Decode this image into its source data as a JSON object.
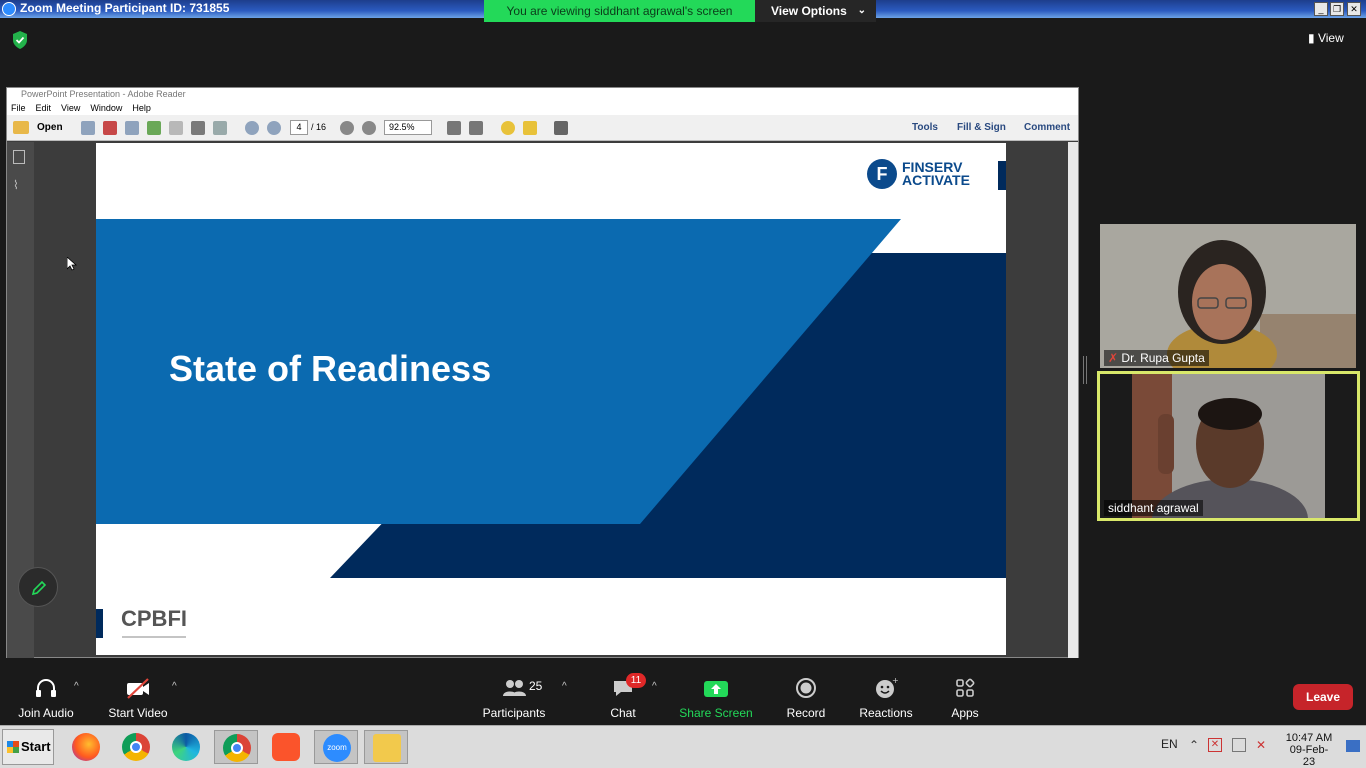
{
  "titlebar": {
    "title": "Zoom Meeting Participant ID: 731855"
  },
  "banner": {
    "viewing": "You are viewing siddhant agrawal's screen",
    "view_options": "View Options"
  },
  "top_right": {
    "view": "View"
  },
  "reader": {
    "window_title": "PowerPoint Presentation - Adobe Reader",
    "menu": [
      "File",
      "Edit",
      "View",
      "Window",
      "Help"
    ],
    "toolbar": {
      "open": "Open",
      "page": "4",
      "page_total": "/ 16",
      "zoom": "92.5%",
      "tools": "Tools",
      "fill_sign": "Fill & Sign",
      "comment": "Comment"
    }
  },
  "slide": {
    "brand_line1": "FINSERV",
    "brand_line2": "ACTIVATE",
    "title": "State of Readiness",
    "footer_brand": "CPBFI"
  },
  "participants": [
    {
      "name": "Dr. Rupa Gupta",
      "muted": true
    },
    {
      "name": "siddhant agrawal",
      "muted": false
    }
  ],
  "controls": {
    "join_audio": "Join Audio",
    "start_video": "Start Video",
    "participants": "Participants",
    "participants_count": "25",
    "chat": "Chat",
    "chat_badge": "11",
    "share_screen": "Share Screen",
    "record": "Record",
    "reactions": "Reactions",
    "apps": "Apps",
    "leave": "Leave"
  },
  "taskbar": {
    "start": "Start",
    "lang": "EN",
    "time": "10:47 AM",
    "date": "09-Feb-23"
  },
  "colors": {
    "banner_green": "#23d959",
    "leave_red": "#c6242a",
    "slide_blue": "#0b6ab0",
    "slide_navy": "#002a5c",
    "active_speaker": "#d9e86a"
  }
}
